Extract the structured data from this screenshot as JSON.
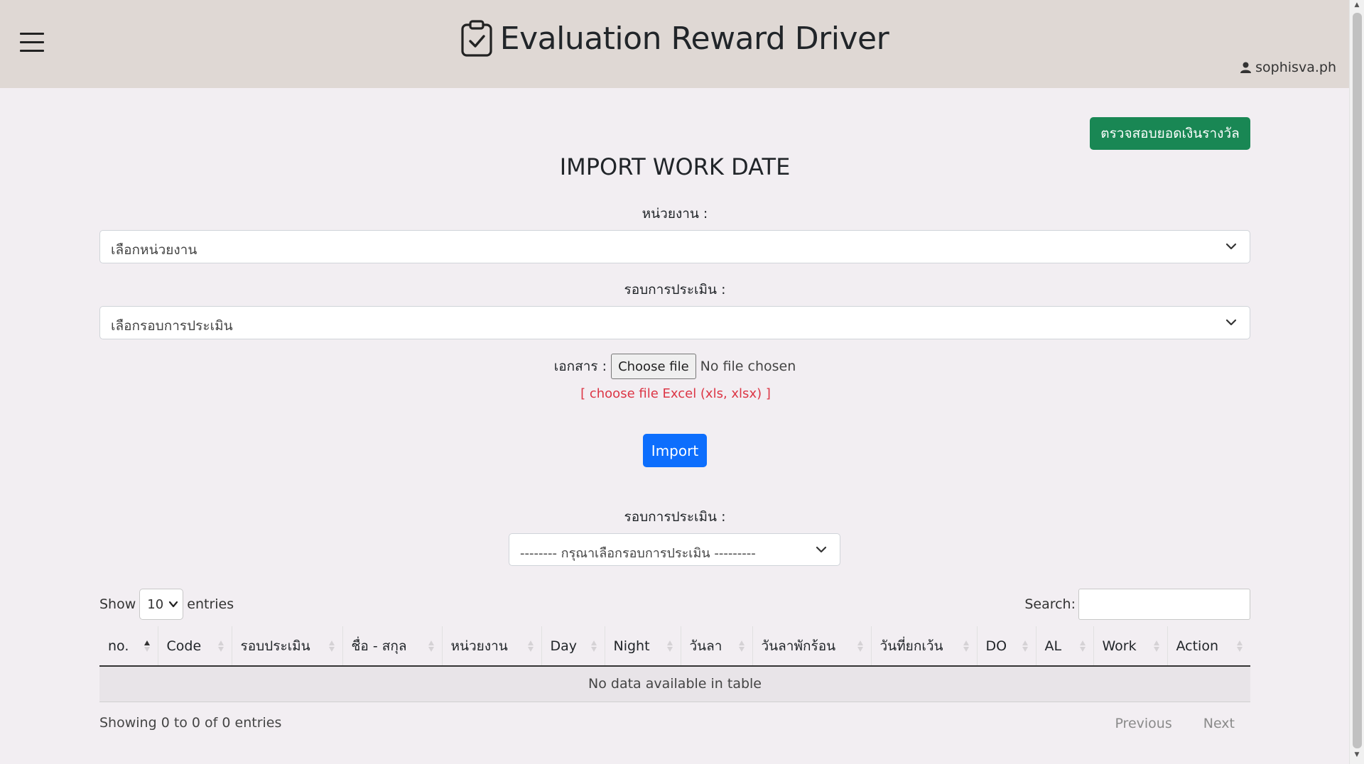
{
  "header": {
    "title": "Evaluation Reward Driver",
    "username": "sophisva.ph"
  },
  "actions": {
    "check_reward_label": "ตรวจสอบยอดเงินรางวัล",
    "import_label": "Import"
  },
  "page_title": "IMPORT WORK DATE",
  "form": {
    "unit_label": "หน่วยงาน :",
    "unit_placeholder": "เลือกหน่วยงาน",
    "round_label": "รอบการประเมิน :",
    "round_placeholder": "เลือกรอบการประเมิน",
    "document_label": "เอกสาร :",
    "choose_file_label": "Choose file",
    "file_status": "No file chosen",
    "file_hint": "[ choose file Excel (xls, xlsx) ]"
  },
  "filter": {
    "round_label": "รอบการประเมิน :",
    "round_placeholder": "-------- กรุณาเลือกรอบการประเมิน ---------"
  },
  "datatable": {
    "show_label": "Show",
    "page_length": "10",
    "entries_label": "entries",
    "search_label": "Search:",
    "columns": [
      "no.",
      "Code",
      "รอบประเมิน",
      "ชื่อ - สกุล",
      "หน่วยงาน",
      "Day",
      "Night",
      "วันลา",
      "วันลาพักร้อน",
      "วันที่ยกเว้น",
      "DO",
      "AL",
      "Work",
      "Action"
    ],
    "empty_message": "No data available in table",
    "info": "Showing 0 to 0 of 0 entries",
    "previous_label": "Previous",
    "next_label": "Next"
  },
  "colors": {
    "header_bg": "#dfd8d4",
    "page_bg": "#f2eef2",
    "success": "#198754",
    "primary": "#0d6efd",
    "danger": "#dc3545"
  }
}
